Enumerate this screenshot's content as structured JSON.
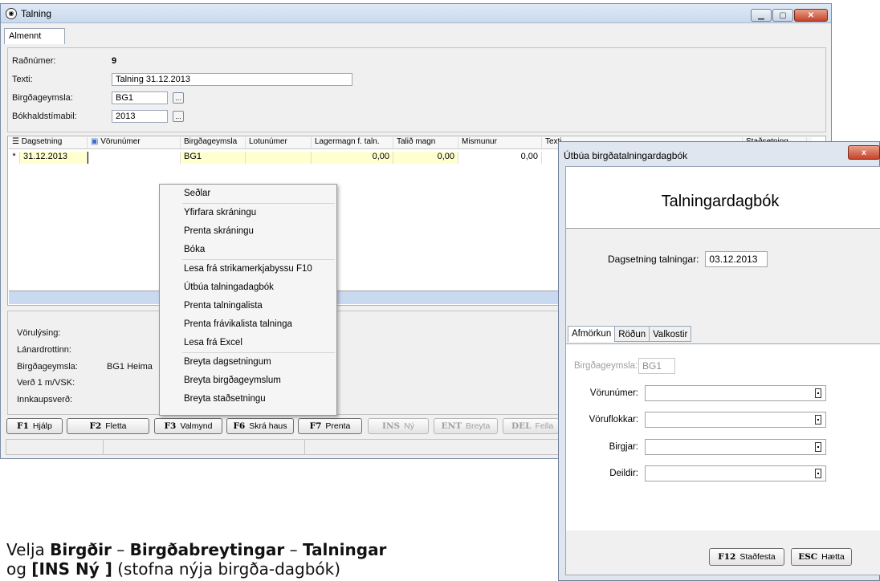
{
  "main_window": {
    "title": "Talning",
    "tab": "Almennt",
    "header": {
      "radnumer_label": "Raðnúmer:",
      "radnumer_value": "9",
      "texti_label": "Texti:",
      "texti_value": "Talning 31.12.2013",
      "birgdageymsla_label": "Birgðageymsla:",
      "birgdageymsla_value": "BG1",
      "bokhald_label": "Bókhaldstímabil:",
      "bokhald_value": "2013",
      "ellipsis": "..."
    },
    "grid": {
      "columns": [
        "Dagsetning",
        "Vörunúmer",
        "Birgðageymsla",
        "Lotunúmer",
        "Lagermagn f. taln.",
        "Talið magn",
        "Mismunur",
        "Texti",
        "Staðsetning"
      ],
      "row": {
        "marker": "*",
        "dagsetning": "31.12.2013",
        "vorunumer": "",
        "birgdageymsla": "BG1",
        "lotunumer": "",
        "lagermagn": "0,00",
        "talid": "0,00",
        "mismunur": "0,00"
      }
    },
    "details": {
      "vorulysing": "Vörulýsing:",
      "lanardrottinn": "Lánardrottinn:",
      "birgdageymsla_label": "Birgðageymsla:",
      "birgdageymsla_value": "BG1 Heima",
      "verd": "Verð 1 m/VSK:",
      "innkaupsverd": "Innkaupsverð:"
    },
    "fkeys": [
      {
        "key": "F1",
        "label": "Hjálp"
      },
      {
        "key": "F2",
        "label": "Fletta"
      },
      {
        "key": "F3",
        "label": "Valmynd"
      },
      {
        "key": "F6",
        "label": "Skrá haus"
      },
      {
        "key": "F7",
        "label": "Prenta"
      },
      {
        "key": "INS",
        "label": "Ný"
      },
      {
        "key": "ENT",
        "label": "Breyta"
      },
      {
        "key": "DEL",
        "label": "Fella"
      }
    ]
  },
  "context_menu": {
    "items": [
      "Seðlar",
      "Yfirfara skráningu",
      "Prenta skráningu",
      "Bóka",
      "Lesa frá strikamerkjabyssu F10",
      "Útbúa talningadagbók",
      "Prenta talningalista",
      "Prenta frávikalista talninga",
      "Lesa frá Excel",
      "Breyta dagsetningum",
      "Breyta birgðageymslum",
      "Breyta staðsetningu"
    ]
  },
  "dialog": {
    "title": "Útbúa birgðatalningardagbók",
    "heading": "Talningardagbók",
    "date_label": "Dagsetning talningar:",
    "date_value": "03.12.2013",
    "tabs": [
      "Afmörkun",
      "Röðun",
      "Valkostir"
    ],
    "fields": {
      "birgdageymsla_label": "Birgðageymsla:",
      "birgdageymsla_value": "BG1",
      "vorunumer_label": "Vörunúmer:",
      "voruflokkar_label": "Vöruflokkar:",
      "birgjar_label": "Birgjar:",
      "deildir_label": "Deildir:"
    },
    "confirm_key": "F12",
    "confirm_label": "Staðfesta",
    "cancel_key": "ESC",
    "cancel_label": "Hætta",
    "close": "x"
  },
  "caption": {
    "t1": "Velja ",
    "b1": "Birgðir",
    "t2": " – ",
    "b2": "Birgðabreytingar",
    "t3": " – ",
    "b3": "Talningar",
    "t4": "og ",
    "b4": "[INS Ný ]",
    "t5": " (stofna nýja birgða-dagbók)"
  },
  "colors": {
    "grid_yellow": "#ffffd0",
    "selection_blue": "#c9d9f0"
  }
}
